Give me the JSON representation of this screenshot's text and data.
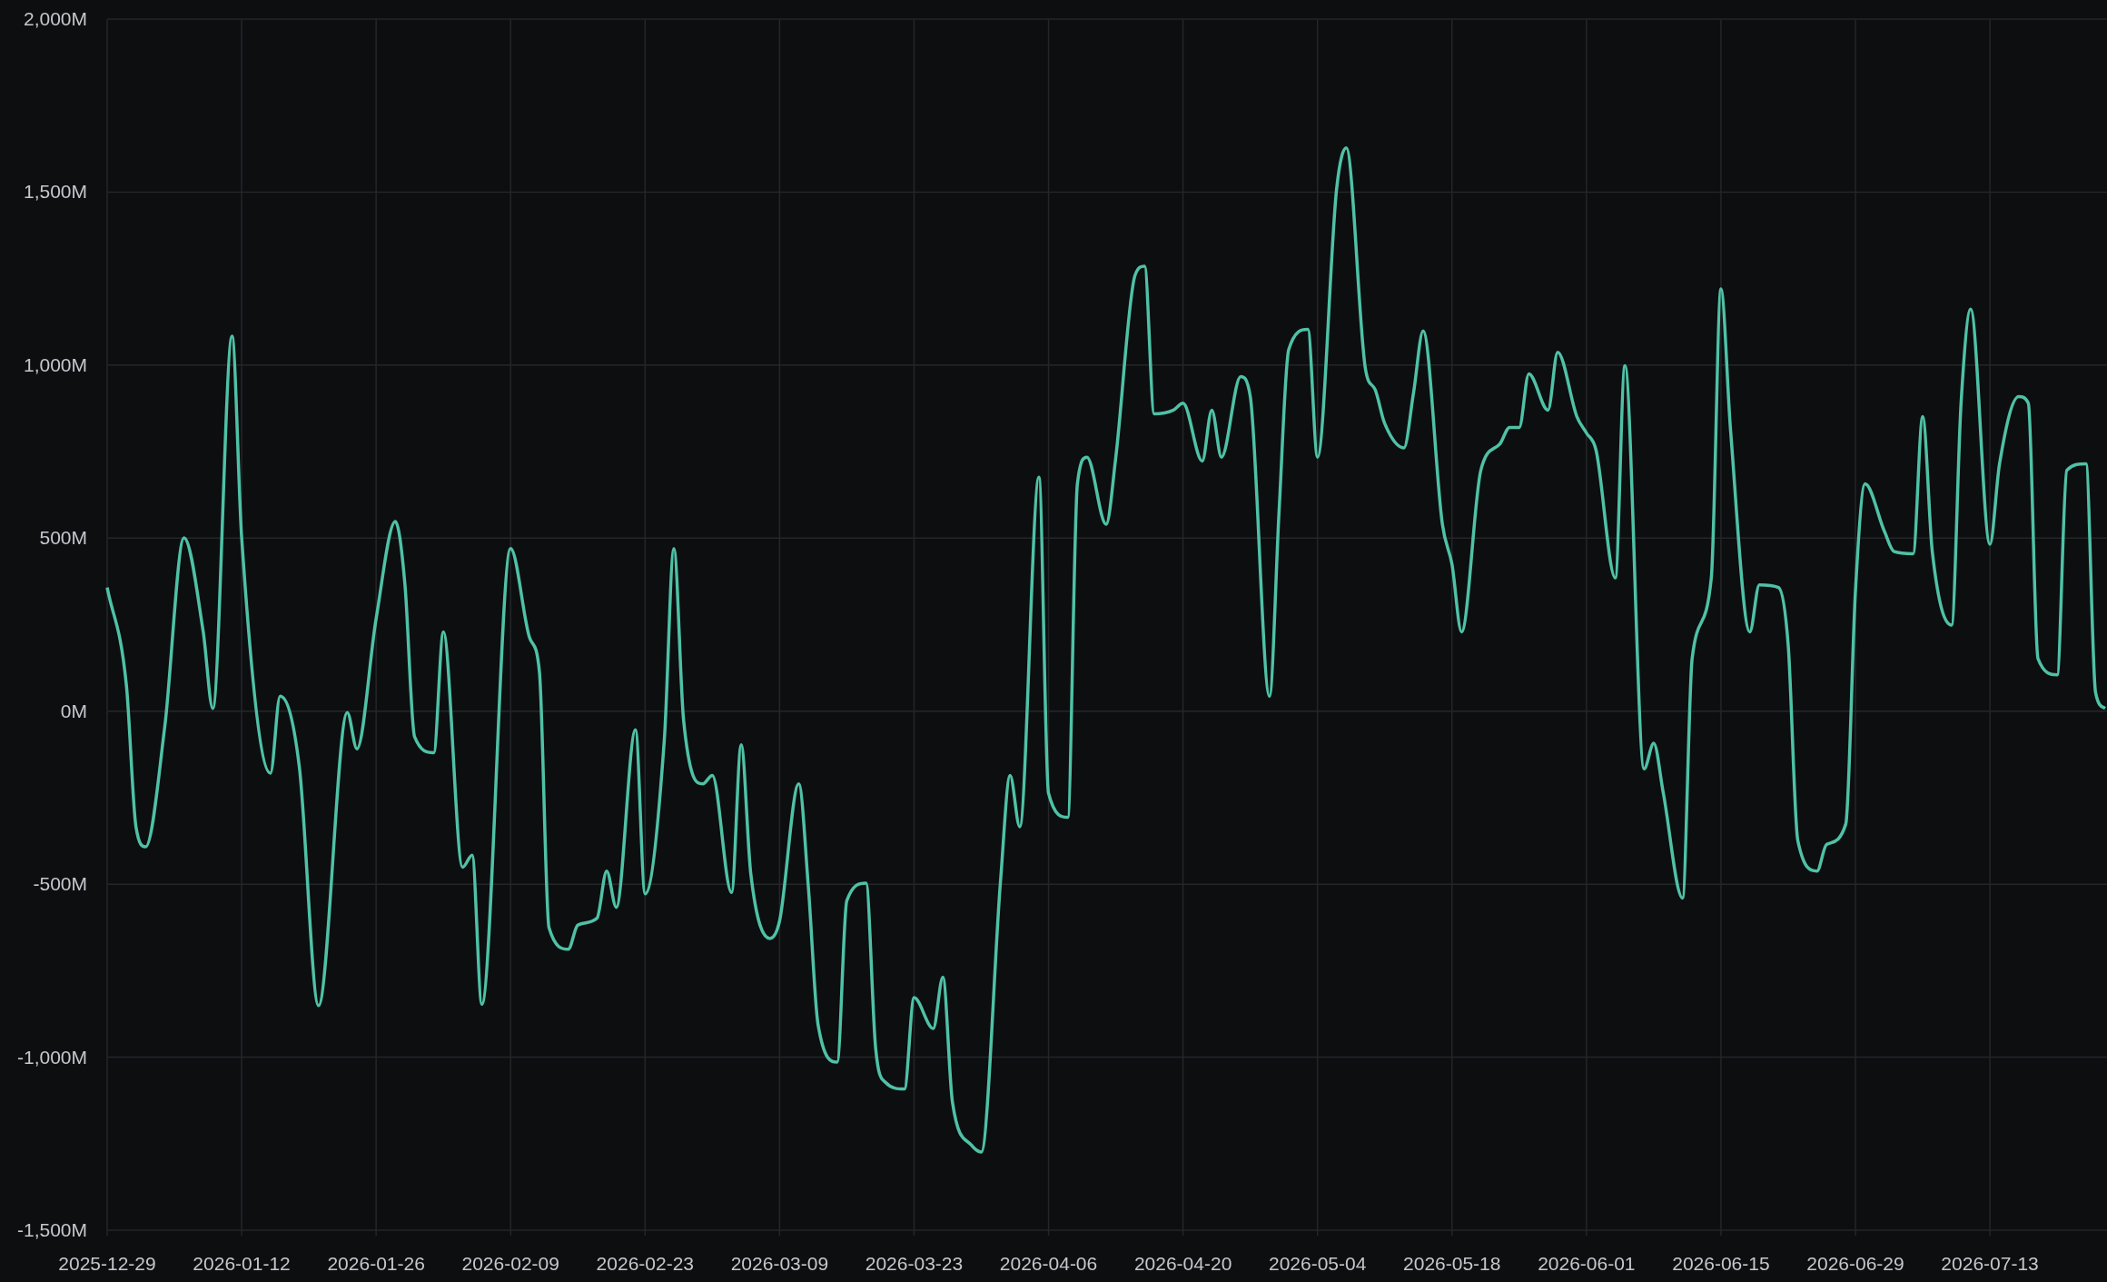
{
  "chart_data": {
    "type": "line",
    "grid": true,
    "xlim": [
      "2025-12-29",
      "2026-07-25"
    ],
    "ylim": [
      -1500,
      2000
    ],
    "xticks": [
      "2025-12-29",
      "2026-01-12",
      "2026-01-26",
      "2026-02-09",
      "2026-02-23",
      "2026-03-09",
      "2026-03-23",
      "2026-04-06",
      "2026-04-20",
      "2026-05-04",
      "2026-05-18",
      "2026-06-01",
      "2026-06-15",
      "2026-06-29",
      "2026-07-13"
    ],
    "yticks": [
      {
        "value": 2000,
        "label": "2,000M"
      },
      {
        "value": 1500,
        "label": "1,500M"
      },
      {
        "value": 1000,
        "label": "1,000M"
      },
      {
        "value": 500,
        "label": "500M"
      },
      {
        "value": 0,
        "label": "0M"
      },
      {
        "value": -500,
        "label": "-500M"
      },
      {
        "value": -1000,
        "label": "-1,000M"
      },
      {
        "value": -1500,
        "label": "-1,500M"
      }
    ],
    "x": [
      "2025-12-29",
      "2025-12-31",
      "2026-01-01",
      "2026-01-02",
      "2026-01-04",
      "2026-01-06",
      "2026-01-08",
      "2026-01-09",
      "2026-01-11",
      "2026-01-12",
      "2026-01-15",
      "2026-01-16",
      "2026-01-18",
      "2026-01-20",
      "2026-01-23",
      "2026-01-24",
      "2026-01-26",
      "2026-01-28",
      "2026-01-29",
      "2026-01-30",
      "2026-02-01",
      "2026-02-02",
      "2026-02-04",
      "2026-02-05",
      "2026-02-06",
      "2026-02-09",
      "2026-02-11",
      "2026-02-12",
      "2026-02-13",
      "2026-02-15",
      "2026-02-16",
      "2026-02-18",
      "2026-02-19",
      "2026-02-20",
      "2026-02-22",
      "2026-02-23",
      "2026-02-25",
      "2026-02-26",
      "2026-02-27",
      "2026-03-01",
      "2026-03-02",
      "2026-03-04",
      "2026-03-05",
      "2026-03-06",
      "2026-03-08",
      "2026-03-09",
      "2026-03-11",
      "2026-03-12",
      "2026-03-13",
      "2026-03-15",
      "2026-03-16",
      "2026-03-18",
      "2026-03-19",
      "2026-03-20",
      "2026-03-22",
      "2026-03-23",
      "2026-03-25",
      "2026-03-26",
      "2026-03-27",
      "2026-03-29",
      "2026-03-30",
      "2026-04-01",
      "2026-04-02",
      "2026-04-03",
      "2026-04-05",
      "2026-04-06",
      "2026-04-08",
      "2026-04-09",
      "2026-04-10",
      "2026-04-12",
      "2026-04-13",
      "2026-04-15",
      "2026-04-16",
      "2026-04-17",
      "2026-04-19",
      "2026-04-20",
      "2026-04-22",
      "2026-04-23",
      "2026-04-24",
      "2026-04-26",
      "2026-04-27",
      "2026-04-29",
      "2026-04-30",
      "2026-05-01",
      "2026-05-03",
      "2026-05-04",
      "2026-05-06",
      "2026-05-07",
      "2026-05-09",
      "2026-05-10",
      "2026-05-11",
      "2026-05-13",
      "2026-05-14",
      "2026-05-15",
      "2026-05-17",
      "2026-05-18",
      "2026-05-19",
      "2026-05-21",
      "2026-05-23",
      "2026-05-24",
      "2026-05-25",
      "2026-05-26",
      "2026-05-28",
      "2026-05-29",
      "2026-05-31",
      "2026-06-01",
      "2026-06-02",
      "2026-06-04",
      "2026-06-05",
      "2026-06-07",
      "2026-06-08",
      "2026-06-09",
      "2026-06-11",
      "2026-06-12",
      "2026-06-14",
      "2026-06-15",
      "2026-06-16",
      "2026-06-18",
      "2026-06-19",
      "2026-06-21",
      "2026-06-22",
      "2026-06-23",
      "2026-06-25",
      "2026-06-26",
      "2026-06-28",
      "2026-06-29",
      "2026-06-30",
      "2026-07-02",
      "2026-07-03",
      "2026-07-05",
      "2026-07-06",
      "2026-07-07",
      "2026-07-09",
      "2026-07-10",
      "2026-07-11",
      "2026-07-13",
      "2026-07-14",
      "2026-07-16",
      "2026-07-17",
      "2026-07-18",
      "2026-07-20",
      "2026-07-21",
      "2026-07-23",
      "2026-07-24",
      "2026-07-25"
    ],
    "series": [
      {
        "color": "#4fc1a6",
        "values": [
          357,
          74,
          -334,
          -392,
          -43,
          501,
          229,
          8,
          1084,
          501,
          -179,
          43,
          -159,
          -851,
          -4,
          -109,
          268,
          548,
          365,
          -74,
          -120,
          229,
          -451,
          -416,
          -847,
          470,
          210,
          113,
          -626,
          -688,
          -618,
          -598,
          -462,
          -567,
          -54,
          -528,
          -82,
          470,
          -23,
          -210,
          -186,
          -524,
          -97,
          -470,
          -657,
          -606,
          -210,
          -509,
          -905,
          -1014,
          -548,
          -497,
          -975,
          -1072,
          -1092,
          -828,
          -917,
          -769,
          -1131,
          -1255,
          -1274,
          -490,
          -186,
          -334,
          676,
          -237,
          -307,
          657,
          734,
          540,
          734,
          1259,
          1286,
          859,
          870,
          890,
          723,
          870,
          734,
          967,
          909,
          43,
          579,
          1045,
          1103,
          734,
          1511,
          1628,
          987,
          929,
          831,
          761,
          921,
          1099,
          540,
          424,
          229,
          696,
          773,
          820,
          820,
          975,
          870,
          1037,
          851,
          804,
          754,
          385,
          998,
          -167,
          -93,
          -237,
          -540,
          152,
          385,
          1220,
          812,
          229,
          365,
          357,
          190,
          -373,
          -462,
          -385,
          -326,
          346,
          657,
          521,
          462,
          455,
          851,
          462,
          249,
          890,
          1162,
          482,
          715,
          909,
          890,
          152,
          105,
          696,
          715,
          54,
          8
        ]
      }
    ]
  }
}
